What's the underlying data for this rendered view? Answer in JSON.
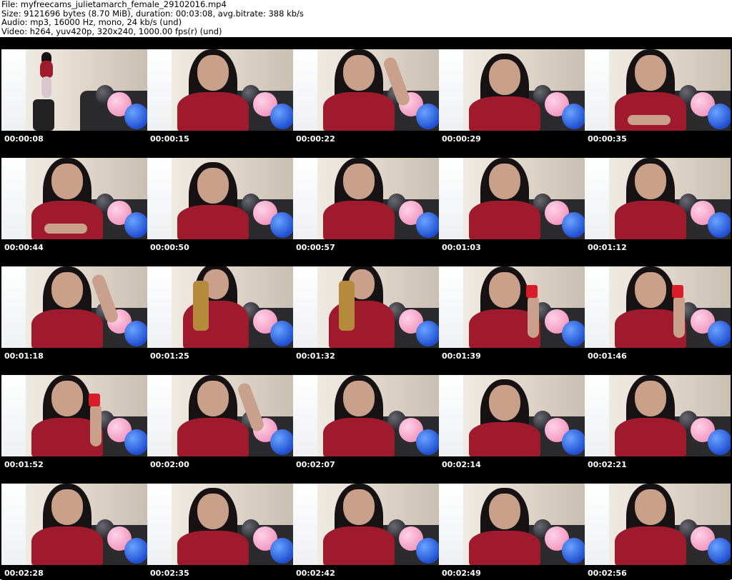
{
  "header": {
    "file_line": "File: myfreecams_julietamarch_female_29102016.mp4",
    "size_line": "Size: 9121696 bytes (8.70 MiB), duration: 00:03:08, avg.bitrate: 388 kb/s",
    "audio_line": "Audio: mp3, 16000 Hz, mono, 24 kb/s (und)",
    "video_line": "Video: h264, yuv420p, 320x240, 1000.00 fps(r) (und)"
  },
  "thumbnails": [
    {
      "time": "00:00:08",
      "pose": "room"
    },
    {
      "time": "00:00:15",
      "pose": "close"
    },
    {
      "time": "00:00:22",
      "pose": "arm-up"
    },
    {
      "time": "00:00:29",
      "pose": "down"
    },
    {
      "time": "00:00:35",
      "pose": "phone"
    },
    {
      "time": "00:00:44",
      "pose": "phone"
    },
    {
      "time": "00:00:50",
      "pose": "down"
    },
    {
      "time": "00:00:57",
      "pose": "close"
    },
    {
      "time": "00:01:03",
      "pose": "close"
    },
    {
      "time": "00:01:12",
      "pose": "close"
    },
    {
      "time": "00:01:18",
      "pose": "arm-up"
    },
    {
      "time": "00:01:25",
      "pose": "bottle"
    },
    {
      "time": "00:01:32",
      "pose": "bottle"
    },
    {
      "time": "00:01:39",
      "pose": "cup"
    },
    {
      "time": "00:01:46",
      "pose": "cup"
    },
    {
      "time": "00:01:52",
      "pose": "cup"
    },
    {
      "time": "00:02:00",
      "pose": "arm-up"
    },
    {
      "time": "00:02:07",
      "pose": "close"
    },
    {
      "time": "00:02:14",
      "pose": "down"
    },
    {
      "time": "00:02:21",
      "pose": "close"
    },
    {
      "time": "00:02:28",
      "pose": "close"
    },
    {
      "time": "00:02:35",
      "pose": "down"
    },
    {
      "time": "00:02:42",
      "pose": "close"
    },
    {
      "time": "00:02:49",
      "pose": "down"
    },
    {
      "time": "00:02:56",
      "pose": "close"
    }
  ]
}
